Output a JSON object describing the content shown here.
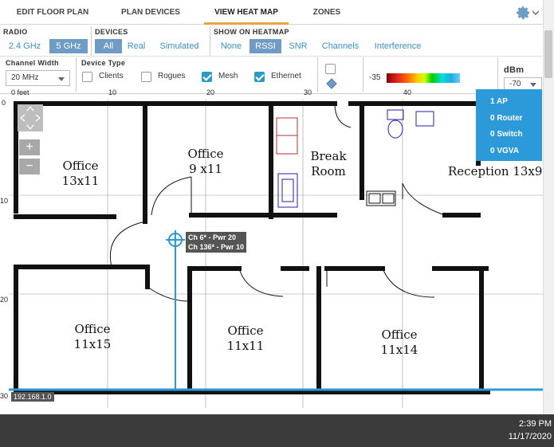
{
  "tabs": [
    {
      "label": "EDIT FLOOR PLAN"
    },
    {
      "label": "PLAN DEVICES"
    },
    {
      "label": "VIEW HEAT MAP"
    },
    {
      "label": "ZONES"
    }
  ],
  "radio": {
    "label": "RADIO",
    "options": [
      "2.4 GHz",
      "5 GHz"
    ],
    "selected": "5 GHz"
  },
  "devices": {
    "label": "DEVICES",
    "options": [
      "All",
      "Real",
      "Simulated"
    ],
    "selected": "All"
  },
  "heatmap": {
    "label": "SHOW ON HEATMAP",
    "options": [
      "None",
      "RSSI",
      "SNR",
      "Channels",
      "Interference"
    ],
    "selected": "RSSI"
  },
  "channel_width": {
    "label": "Channel Width",
    "value": "20 MHz"
  },
  "device_type": {
    "label": "Device Type",
    "items": [
      {
        "label": "Clients",
        "checked": false
      },
      {
        "label": "Rogues",
        "checked": false
      },
      {
        "label": "Mesh",
        "checked": true
      },
      {
        "label": "Ethernet",
        "checked": true
      }
    ]
  },
  "legend": {
    "min_label": "-35"
  },
  "dbm": {
    "label": "dBm",
    "value": "-70"
  },
  "ruler": {
    "x_labels": [
      "0 feet",
      "10",
      "20",
      "30",
      "40"
    ],
    "y_labels": [
      "0",
      "10",
      "20",
      "30"
    ]
  },
  "zoom": {
    "plus": "+",
    "minus": "−"
  },
  "summary": [
    "1 AP",
    "0 Router",
    "0 Switch",
    "0 VGVA"
  ],
  "rooms": [
    {
      "name": "Office",
      "size": "13x11"
    },
    {
      "name": "Office",
      "size": "9 x11"
    },
    {
      "name": "Break",
      "size": "Room"
    },
    {
      "name": "Reception 13x9",
      "size": ""
    },
    {
      "name": "Office",
      "size": "11x15"
    },
    {
      "name": "Office",
      "size": "11x11"
    },
    {
      "name": "Office",
      "size": "11x14"
    }
  ],
  "ap": {
    "line1": "Ch 6* - Pwr 20",
    "line2": "Ch 136* - Pwr 10"
  },
  "ip_label": "192.168.1.0",
  "taskbar": {
    "time": "2:39 PM",
    "date": "11/17/2020"
  },
  "colors": {
    "accent": "#2c9ad8",
    "tab_active": "#e8a343",
    "segment_on": "#6f9cc4",
    "link": "#3a8fc6"
  }
}
